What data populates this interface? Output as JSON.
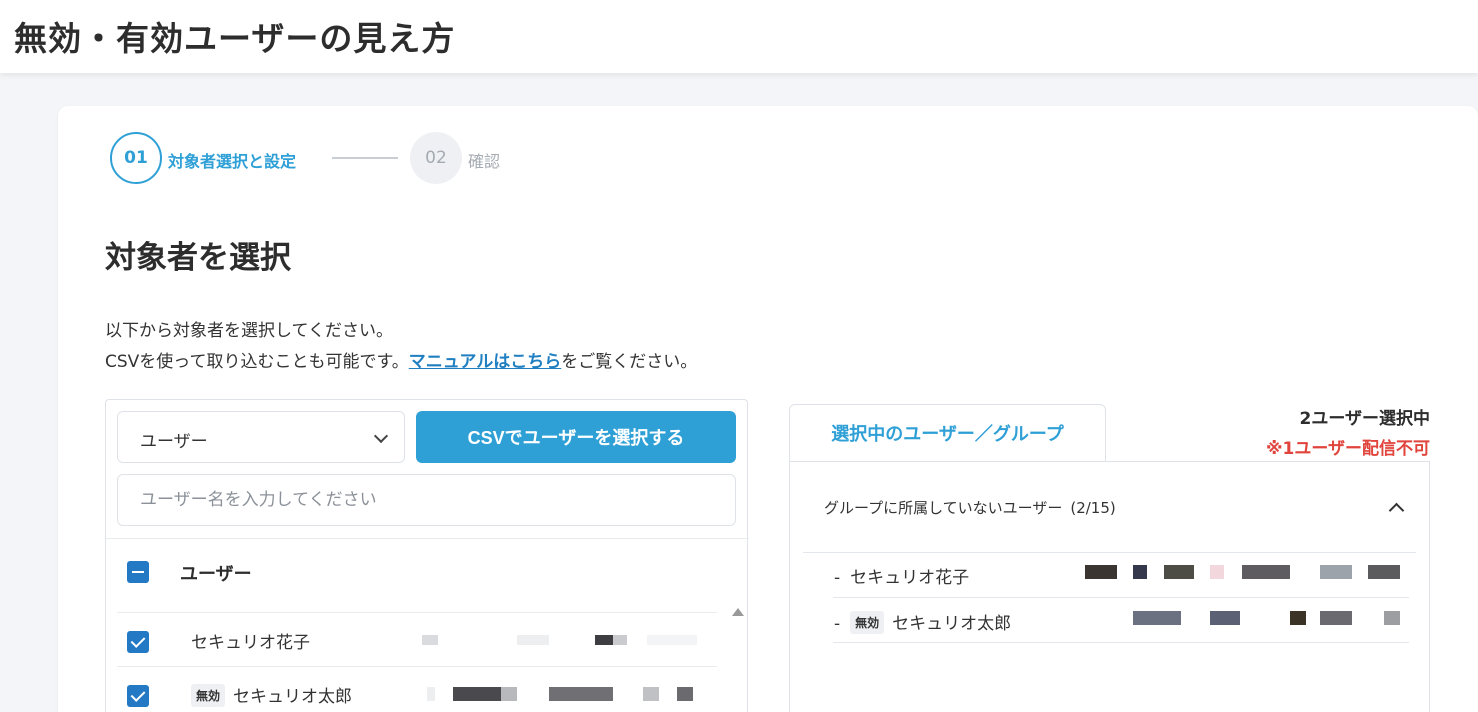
{
  "page": {
    "title": "無効・有効ユーザーの見え方"
  },
  "stepper": {
    "steps": [
      {
        "number": "01",
        "label": "対象者選択と設定",
        "state": "active"
      },
      {
        "number": "02",
        "label": "確認",
        "state": "inactive"
      }
    ]
  },
  "section": {
    "title": "対象者を選択",
    "description_line1": "以下から対象者を選択してください。",
    "description_line2_prefix": "CSVを使って取り込むことも可能です。",
    "manual_link": "マニュアルはこちら",
    "description_line2_suffix": "をご覧ください。"
  },
  "left_panel": {
    "type_select_value": "ユーザー",
    "csv_button_label": "CSVでユーザーを選択する",
    "search_placeholder": "ユーザー名を入力してください",
    "list_header_label": "ユーザー",
    "users": [
      {
        "name": "セキュリオ花子",
        "badge": "",
        "checked": true
      },
      {
        "name": "セキュリオ太郎",
        "badge": "無効",
        "checked": true
      }
    ]
  },
  "right_panel": {
    "tab_label": "選択中のユーザー／グループ",
    "selected_count": "2ユーザー選択中",
    "warning": "※1ユーザー配信不可",
    "group_title": "グループに所属していないユーザー",
    "group_count": "(2/15)",
    "users": [
      {
        "dash": "-",
        "badge": "",
        "name": "セキュリオ花子"
      },
      {
        "dash": "-",
        "badge": "無効",
        "name": "セキュリオ太郎"
      }
    ]
  },
  "colors": {
    "accent": "#2ea0d6",
    "link": "#1f7fc0",
    "checkbox": "#2479c5",
    "warning": "#e0443d"
  },
  "icons": [
    "chevron-down-icon",
    "chevron-up-icon",
    "checkbox-minus-icon",
    "checkbox-checked-icon",
    "scroll-up-icon"
  ]
}
